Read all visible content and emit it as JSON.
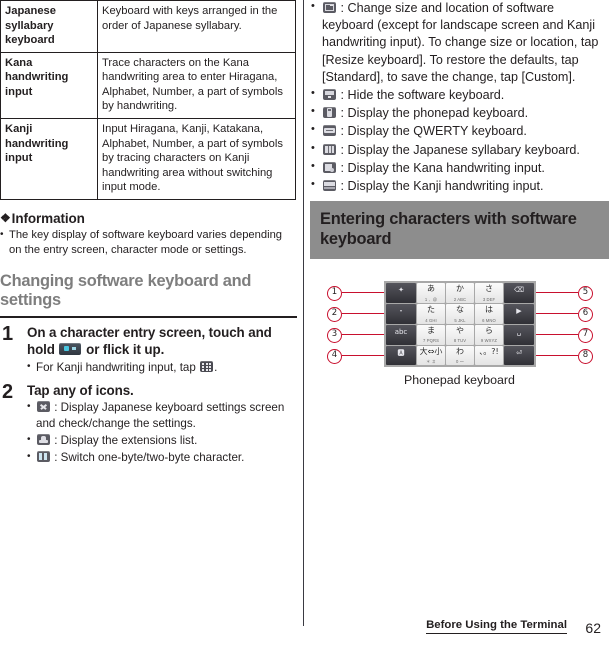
{
  "table": {
    "rows": [
      {
        "term": "Japanese syllabary keyboard",
        "definition": "Keyboard with keys arranged in the order of Japanese syllabary."
      },
      {
        "term": "Kana handwriting input",
        "definition": "Trace characters on the Kana handwriting area to enter Hiragana, Alphabet, Number, a part of symbols by handwriting."
      },
      {
        "term": "Kanji handwriting input",
        "definition": "Input Hiragana, Kanji, Katakana, Alphabet, Number, a part of symbols by tracing characters on Kanji handwriting area without switching input mode."
      }
    ]
  },
  "information": {
    "heading": "Information",
    "diamond": "❖",
    "items": [
      "The key display of software keyboard varies depending on the entry screen, character mode or settings."
    ]
  },
  "section_left": {
    "heading": "Changing software keyboard and settings"
  },
  "steps": [
    {
      "number": "1",
      "title_before": "On a character entry screen, touch and hold",
      "icon": "software-keyboard-key-icon",
      "title_after": "or flick it up.",
      "bullets": [
        {
          "text_before": "For Kanji handwriting input, tap",
          "icon": "kanji-grid-icon",
          "text_after": "."
        }
      ]
    },
    {
      "number": "2",
      "title": "Tap any of icons.",
      "bullets": [
        {
          "icon": "japanese-keyboard-settings-icon",
          "text": ": Display Japanese keyboard settings screen and check/change the settings."
        },
        {
          "icon": "extensions-list-icon",
          "text": ": Display the extensions list."
        },
        {
          "icon": "byte-switch-icon",
          "text": ": Switch one-byte/two-byte character."
        }
      ]
    }
  ],
  "right_bullets": [
    {
      "icon": "resize-keyboard-icon",
      "text": ": Change size and location of software keyboard (except for landscape screen and Kanji handwriting input).",
      "text2": "To change size or location, tap [Resize keyboard]. To restore the defaults, tap [Standard], to save the change, tap [Custom]."
    },
    {
      "icon": "hide-keyboard-icon",
      "text": ": Hide the software keyboard."
    },
    {
      "icon": "phonepad-keyboard-icon",
      "text": ": Display the phonepad keyboard."
    },
    {
      "icon": "qwerty-keyboard-icon",
      "text": ": Display the QWERTY keyboard."
    },
    {
      "icon": "japanese-syllabary-keyboard-icon",
      "text": ": Display the Japanese syllabary keyboard."
    },
    {
      "icon": "kana-handwriting-icon",
      "text": ": Display the Kana handwriting input."
    },
    {
      "icon": "kanji-handwriting-icon",
      "text": ": Display the Kanji handwriting input."
    }
  ],
  "banner": {
    "heading": "Entering characters with software keyboard"
  },
  "figure": {
    "caption": "Phonepad keyboard",
    "callouts": [
      "1",
      "2",
      "3",
      "4",
      "5",
      "6",
      "7",
      "8"
    ],
    "keys": [
      {
        "glyph": "✦",
        "sub": "",
        "dark": true
      },
      {
        "glyph": "あ",
        "sub": "1  ．@",
        "dark": false
      },
      {
        "glyph": "か",
        "sub": "2  ABC",
        "dark": false
      },
      {
        "glyph": "さ",
        "sub": "3  DEF",
        "dark": false
      },
      {
        "glyph": "⌫",
        "sub": "",
        "dark": true
      },
      {
        "glyph": "・",
        "sub": "",
        "dark": true
      },
      {
        "glyph": "た",
        "sub": "4  GHI",
        "dark": false
      },
      {
        "glyph": "な",
        "sub": "5  JKL",
        "dark": false
      },
      {
        "glyph": "は",
        "sub": "6  MNO",
        "dark": false
      },
      {
        "glyph": "▶",
        "sub": "",
        "dark": true
      },
      {
        "glyph": "abc",
        "sub": "",
        "dark": true
      },
      {
        "glyph": "ま",
        "sub": "7  PQRS",
        "dark": false
      },
      {
        "glyph": "や",
        "sub": "8  TUV",
        "dark": false
      },
      {
        "glyph": "ら",
        "sub": "9  WXYZ",
        "dark": false
      },
      {
        "glyph": "␣",
        "sub": "",
        "dark": true
      },
      {
        "glyph": "🅰",
        "sub": "",
        "dark": true
      },
      {
        "glyph": "大⇔小",
        "sub": "＊  ＃",
        "dark": false
      },
      {
        "glyph": "わ",
        "sub": "0  〜",
        "dark": false
      },
      {
        "glyph": "、。?!",
        "sub": "",
        "dark": false
      },
      {
        "glyph": "⏎",
        "sub": "",
        "dark": true
      }
    ]
  },
  "footer": {
    "title": "Before Using the Terminal",
    "page": "62"
  }
}
